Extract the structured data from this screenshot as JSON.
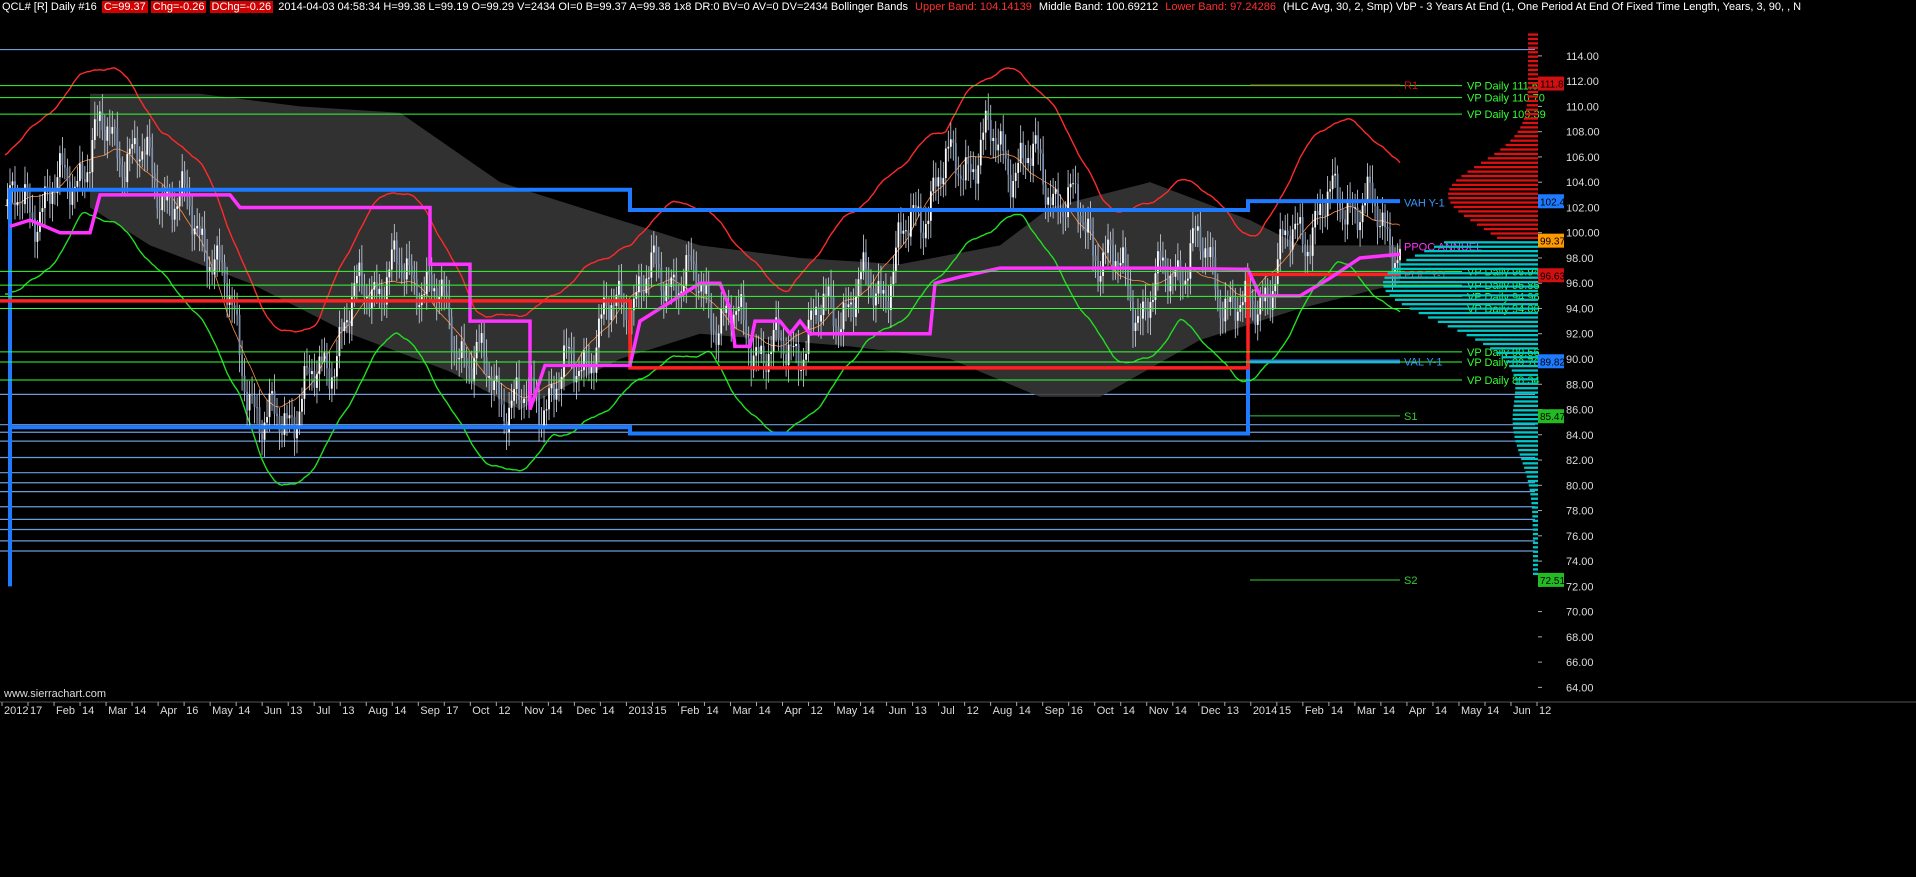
{
  "header": {
    "symbol": "QCL# [R]  Daily  #16",
    "close": "C=99.37",
    "chg": "Chg=-0.26",
    "dchg": "DChg=-0.26",
    "rest": "2014-04-03 04:58:34 H=99.38 L=99.19 O=99.29 V=2434 OI=0 B=99.37 A=99.38 1x8 DR:0 BV=0 AV=0 DV=2434  Bollinger Bands",
    "upper": "Upper Band: 104.14139",
    "middle": "Middle Band: 100.69212",
    "lower": "Lower Band: 97.24286",
    "tail": "(HLC Avg, 30, 2, Smp)  VbP - 3 Years At End   (1, One Period At End Of Fixed Time Length, Years, 3, 90, , N"
  },
  "watermark": "www.sierrachart.com",
  "colors": {
    "background": "#000000",
    "upper_band": "#ff2a2a",
    "lower_band": "#22dd22",
    "middle_band": "#ff8c40",
    "poc": "#ff33ff",
    "value_area": "#1e7bff",
    "vp_daily": "#33ff33",
    "price_tag": "#ff9900",
    "volume_profile_up": "#e01010",
    "volume_profile_down": "#00c8c8"
  },
  "chart_data": {
    "type": "candlestick",
    "ylim": [
      63,
      117
    ],
    "yticks": [
      "114.00",
      "112.00",
      "110.00",
      "108.00",
      "106.00",
      "104.00",
      "102.00",
      "100.00",
      "98.00",
      "96.00",
      "94.00",
      "92.00",
      "90.00",
      "88.00",
      "86.00",
      "84.00",
      "82.00",
      "80.00",
      "78.00",
      "76.00",
      "74.00",
      "72.00",
      "70.00",
      "68.00",
      "66.00",
      "64.00"
    ],
    "xticks": [
      "2012",
      "17",
      "Feb",
      "14",
      "Mar",
      "14",
      "Apr",
      "16",
      "May",
      "14",
      "Jun",
      "13",
      "Jul",
      "13",
      "Aug",
      "14",
      "Sep",
      "17",
      "Oct",
      "12",
      "Nov",
      "14",
      "Dec",
      "14",
      "2013",
      "15",
      "Feb",
      "14",
      "Mar",
      "14",
      "Apr",
      "12",
      "May",
      "14",
      "Jun",
      "13",
      "Jul",
      "12",
      "Aug",
      "14",
      "Sep",
      "16",
      "Oct",
      "14",
      "Nov",
      "14",
      "Dec",
      "13",
      "2014",
      "15",
      "Feb",
      "14",
      "Mar",
      "14",
      "Apr",
      "14",
      "May",
      "14",
      "Jun",
      "12"
    ],
    "price_series": [
      {
        "date": "2012-01",
        "close": 101.5
      },
      {
        "date": "2012-02",
        "close": 103
      },
      {
        "date": "2012-03",
        "close": 108
      },
      {
        "date": "2012-04",
        "close": 104
      },
      {
        "date": "2012-05",
        "close": 99
      },
      {
        "date": "2012-06",
        "close": 84
      },
      {
        "date": "2012-07",
        "close": 88
      },
      {
        "date": "2012-08",
        "close": 96
      },
      {
        "date": "2012-09",
        "close": 97
      },
      {
        "date": "2012-10",
        "close": 90
      },
      {
        "date": "2012-11",
        "close": 86
      },
      {
        "date": "2012-12",
        "close": 89
      },
      {
        "date": "2013-01",
        "close": 95
      },
      {
        "date": "2013-02",
        "close": 97
      },
      {
        "date": "2013-03",
        "close": 93
      },
      {
        "date": "2013-04",
        "close": 90
      },
      {
        "date": "2013-05",
        "close": 94
      },
      {
        "date": "2013-06",
        "close": 96
      },
      {
        "date": "2013-07",
        "close": 104
      },
      {
        "date": "2013-08",
        "close": 107
      },
      {
        "date": "2013-09",
        "close": 105
      },
      {
        "date": "2013-10",
        "close": 100
      },
      {
        "date": "2013-11",
        "close": 94
      },
      {
        "date": "2013-12",
        "close": 99
      },
      {
        "date": "2014-01",
        "close": 93
      },
      {
        "date": "2014-02",
        "close": 100
      },
      {
        "date": "2014-03",
        "close": 103
      },
      {
        "date": "2014-04",
        "close": 99.37
      }
    ],
    "levels": [
      {
        "label": "VP Daily 111.65",
        "value": 111.65,
        "color": "#33ff33"
      },
      {
        "label": "VP Daily 110.70",
        "value": 110.7,
        "color": "#33ff33"
      },
      {
        "label": "VP Daily 109.39",
        "value": 109.39,
        "color": "#33ff33"
      },
      {
        "label": "VP Daily 96.94",
        "value": 96.94,
        "color": "#33ff33"
      },
      {
        "label": "VP Daily 95.85",
        "value": 95.85,
        "color": "#33ff33"
      },
      {
        "label": "VP Daily 94.96",
        "value": 94.96,
        "color": "#33ff33"
      },
      {
        "label": "VP Daily 94.00",
        "value": 94.0,
        "color": "#33ff33"
      },
      {
        "label": "VP Daily 90.56",
        "value": 90.56,
        "color": "#33ff33"
      },
      {
        "label": "VP Daily 89.76",
        "value": 89.76,
        "color": "#33ff33"
      },
      {
        "label": "VP Daily 88.34",
        "value": 88.34,
        "color": "#33ff33"
      }
    ],
    "annotations": [
      {
        "label": "R1",
        "value": 111.7,
        "color": "#d01010"
      },
      {
        "label": "VAH Y-1",
        "value": 102.4,
        "color": "#3399ff"
      },
      {
        "label": "PPOC ANNUEL",
        "value": 98.9,
        "color": "#ff33ff"
      },
      {
        "label": "POC Y-1",
        "value": 96.7,
        "color": "#ff3030"
      },
      {
        "label": "VAL Y-1",
        "value": 89.8,
        "color": "#3399ff"
      },
      {
        "label": "S1",
        "value": 85.5,
        "color": "#33cc33"
      },
      {
        "label": "S2",
        "value": 72.5,
        "color": "#33cc33"
      }
    ],
    "price_tags": [
      {
        "label": "111.81",
        "value": 111.81,
        "color": "#d01010"
      },
      {
        "label": "102.49",
        "value": 102.49,
        "color": "#1e7bff"
      },
      {
        "label": "99.37",
        "value": 99.37,
        "color": "#ff9900"
      },
      {
        "label": "96.63",
        "value": 96.63,
        "color": "#d01010"
      },
      {
        "label": "89.82",
        "value": 89.82,
        "color": "#1e7bff"
      },
      {
        "label": "85.47",
        "value": 85.47,
        "color": "#22bb22"
      },
      {
        "label": "72.51",
        "value": 72.51,
        "color": "#22bb22"
      }
    ]
  }
}
